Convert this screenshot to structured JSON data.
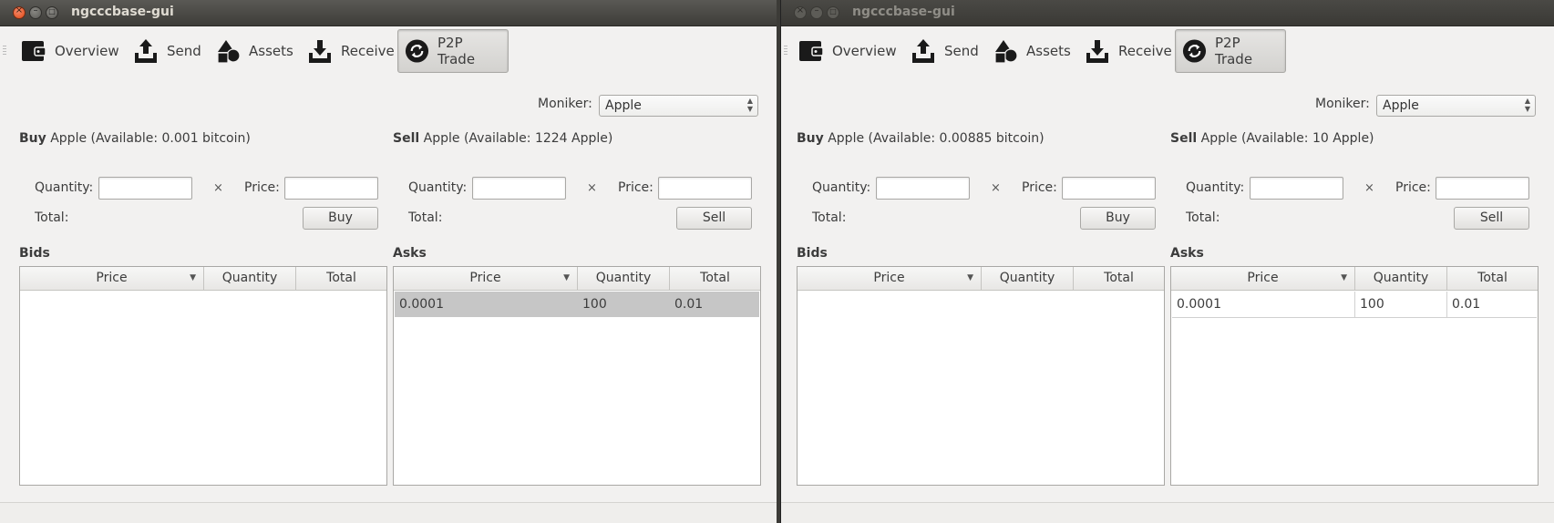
{
  "windows": [
    {
      "title": "ngcccbase-gui",
      "toolbar": {
        "overview": "Overview",
        "send": "Send",
        "assets": "Assets",
        "receive": "Receive",
        "p2p_trade": "P2P Trade"
      },
      "moniker": {
        "label": "Moniker:",
        "value": "Apple"
      },
      "buy": {
        "bold": "Buy",
        "text": " Apple (Available: 0.001 bitcoin)",
        "quantity_label": "Quantity:",
        "times": "×",
        "price_label": "Price:",
        "total_label": "Total:",
        "button": "Buy"
      },
      "sell": {
        "bold": "Sell",
        "text": " Apple (Available: 1224 Apple)",
        "quantity_label": "Quantity:",
        "times": "×",
        "price_label": "Price:",
        "total_label": "Total:",
        "button": "Sell"
      },
      "bids": {
        "heading": "Bids",
        "columns": [
          "Price",
          "Quantity",
          "Total"
        ],
        "rows": []
      },
      "asks": {
        "heading": "Asks",
        "columns": [
          "Price",
          "Quantity",
          "Total"
        ],
        "rows": [
          {
            "price": "0.0001",
            "quantity": "100",
            "total": "0.01",
            "selected": true
          }
        ]
      }
    },
    {
      "title": "ngcccbase-gui",
      "toolbar": {
        "overview": "Overview",
        "send": "Send",
        "assets": "Assets",
        "receive": "Receive",
        "p2p_trade": "P2P Trade"
      },
      "moniker": {
        "label": "Moniker:",
        "value": "Apple"
      },
      "buy": {
        "bold": "Buy",
        "text": " Apple (Available: 0.00885 bitcoin)",
        "quantity_label": "Quantity:",
        "times": "×",
        "price_label": "Price:",
        "total_label": "Total:",
        "button": "Buy"
      },
      "sell": {
        "bold": "Sell",
        "text": " Apple (Available: 10 Apple)",
        "quantity_label": "Quantity:",
        "times": "×",
        "price_label": "Price:",
        "total_label": "Total:",
        "button": "Sell"
      },
      "bids": {
        "heading": "Bids",
        "columns": [
          "Price",
          "Quantity",
          "Total"
        ],
        "rows": []
      },
      "asks": {
        "heading": "Asks",
        "columns": [
          "Price",
          "Quantity",
          "Total"
        ],
        "rows": [
          {
            "price": "0.0001",
            "quantity": "100",
            "total": "0.01",
            "selected": false
          }
        ]
      }
    }
  ],
  "colors": {
    "window_bg": "#f2f1f0",
    "titlebar": "#3e3d39",
    "close_button": "#df4a16",
    "selected_row": "#c6c6c6"
  },
  "icons": {
    "close": "close-icon",
    "minimize": "minimize-icon",
    "maximize": "maximize-icon",
    "overview": "wallet-icon",
    "send": "upload-tray-icon",
    "assets": "shapes-icon",
    "receive": "download-tray-icon",
    "p2p_trade": "sync-icon"
  }
}
